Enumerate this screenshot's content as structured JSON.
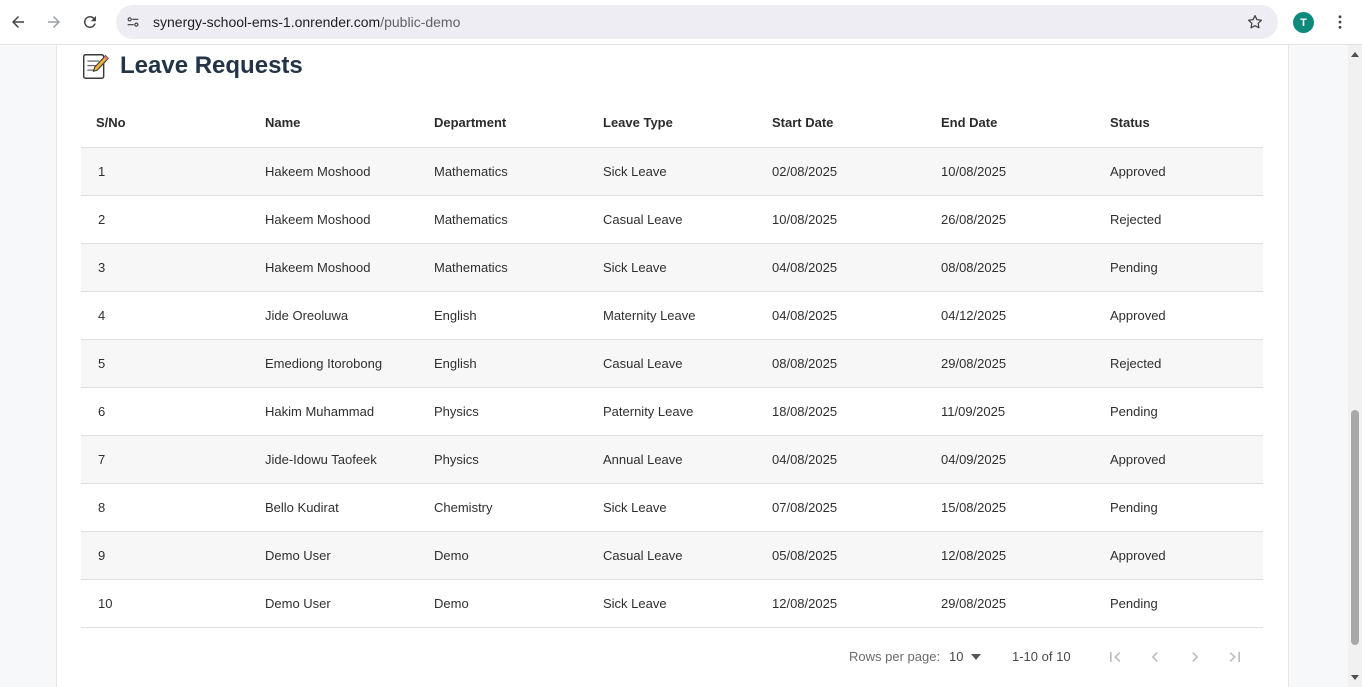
{
  "browser": {
    "url_host": "synergy-school-ems-1.onrender.com",
    "url_path": "/public-demo",
    "profile_initial": "T"
  },
  "page": {
    "title": "Leave Requests",
    "title_icon": "memo-icon"
  },
  "table": {
    "headers": [
      "S/No",
      "Name",
      "Department",
      "Leave Type",
      "Start Date",
      "End Date",
      "Status"
    ],
    "rows": [
      [
        "1",
        "Hakeem Moshood",
        "Mathematics",
        "Sick Leave",
        "02/08/2025",
        "10/08/2025",
        "Approved"
      ],
      [
        "2",
        "Hakeem Moshood",
        "Mathematics",
        "Casual Leave",
        "10/08/2025",
        "26/08/2025",
        "Rejected"
      ],
      [
        "3",
        "Hakeem Moshood",
        "Mathematics",
        "Sick Leave",
        "04/08/2025",
        "08/08/2025",
        "Pending"
      ],
      [
        "4",
        "Jide Oreoluwa",
        "English",
        "Maternity Leave",
        "04/08/2025",
        "04/12/2025",
        "Approved"
      ],
      [
        "5",
        "Emediong Itorobong",
        "English",
        "Casual Leave",
        "08/08/2025",
        "29/08/2025",
        "Rejected"
      ],
      [
        "6",
        "Hakim Muhammad",
        "Physics",
        "Paternity Leave",
        "18/08/2025",
        "11/09/2025",
        "Pending"
      ],
      [
        "7",
        "Jide-Idowu Taofeek",
        "Physics",
        "Annual Leave",
        "04/08/2025",
        "04/09/2025",
        "Approved"
      ],
      [
        "8",
        "Bello Kudirat",
        "Chemistry",
        "Sick Leave",
        "07/08/2025",
        "15/08/2025",
        "Pending"
      ],
      [
        "9",
        "Demo User",
        "Demo",
        "Casual Leave",
        "05/08/2025",
        "12/08/2025",
        "Approved"
      ],
      [
        "10",
        "Demo User",
        "Demo",
        "Sick Leave",
        "12/08/2025",
        "29/08/2025",
        "Pending"
      ]
    ]
  },
  "pagination": {
    "rows_per_page_label": "Rows per page:",
    "rows_per_page_value": "10",
    "range_text": "1-10 of 10"
  }
}
